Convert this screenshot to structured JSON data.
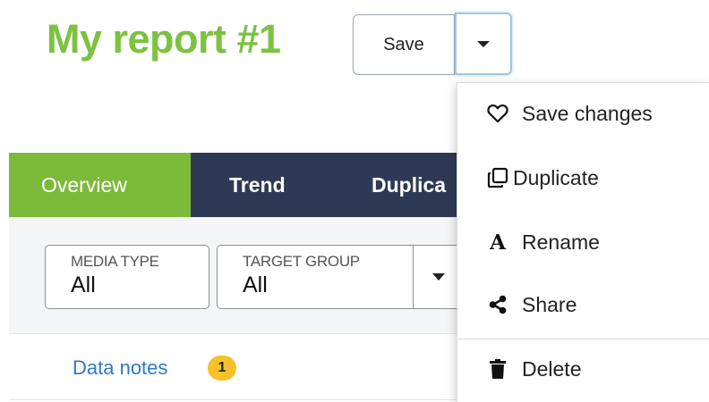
{
  "header": {
    "title": "My report #1",
    "save_label": "Save"
  },
  "tabs": [
    {
      "label": "Overview",
      "active": true
    },
    {
      "label": "Trend",
      "active": false
    },
    {
      "label": "Duplica",
      "active": false
    }
  ],
  "filters": [
    {
      "label": "MEDIA TYPE",
      "value": "All"
    },
    {
      "label": "TARGET GROUP",
      "value": "All"
    }
  ],
  "data_notes": {
    "label": "Data notes",
    "count": "1"
  },
  "dropdown_menu": {
    "items": [
      {
        "label": "Save changes",
        "icon": "heart-icon"
      },
      {
        "label": "Duplicate",
        "icon": "copy-icon"
      },
      {
        "label": "Rename",
        "icon": "rename-icon",
        "icon_glyph": "A"
      },
      {
        "label": "Share",
        "icon": "share-icon"
      },
      {
        "label": "Delete",
        "icon": "trash-icon"
      }
    ]
  },
  "colors": {
    "title_green": "#7cc242",
    "tab_active": "#7cba3a",
    "tab_bar": "#2e3a55",
    "link_blue": "#2e78c8",
    "badge_yellow": "#f6c12c"
  }
}
